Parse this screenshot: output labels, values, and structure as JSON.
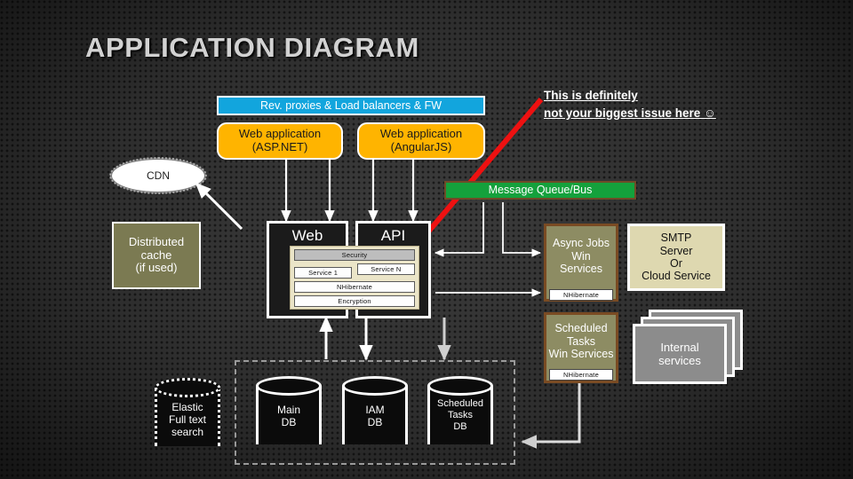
{
  "slide": {
    "title": "APPLICATION DIAGRAM",
    "background_color": "#323232",
    "annotation": {
      "line1": "This is definitely",
      "line2": "not your biggest issue here ☺",
      "arrow_color": "#ee1111"
    }
  },
  "colors": {
    "blue_bar": "#12a5dd",
    "gold": "#ffb400",
    "green_bar": "#14a13c",
    "olive": "#7b7a52",
    "olive_brown": "#8d8c63",
    "cream": "#ded8b0",
    "grey_card": "#8c8c8c",
    "white": "#ffffff",
    "red_arrow": "#ee1111"
  },
  "nodes": {
    "load_balancers": "Rev. proxies & Load balancers & FW",
    "web_app_aspnet": {
      "line1": "Web application",
      "line2": "(ASP.NET)"
    },
    "web_app_angular": {
      "line1": "Web application",
      "line2": "(AngularJS)"
    },
    "cdn": "CDN",
    "message_queue": "Message Queue/Bus",
    "distributed_cache": {
      "line1": "Distributed",
      "line2": "cache",
      "line3": "(if used)"
    },
    "web": "Web",
    "api": "API",
    "async_jobs": {
      "line1": "Async Jobs",
      "line2": "Win",
      "line3": "Services",
      "tag": "NHibernate"
    },
    "smtp": {
      "line1": "SMTP",
      "line2": "Server",
      "line3": "Or",
      "line4": "Cloud Service"
    },
    "scheduled_tasks": {
      "line1": "Scheduled",
      "line2": "Tasks",
      "line3": "Win Services",
      "tag": "NHibernate"
    },
    "internal_services": {
      "line1": "Internal",
      "line2": "services"
    }
  },
  "stack": {
    "security": "Security",
    "service_first": "Service 1",
    "service_last": "Service N",
    "nhibernate": "NHibernate",
    "encryption": "Encryption"
  },
  "databases": [
    {
      "name": "elastic",
      "line1": "Elastic",
      "line2": "Full text",
      "line3": "search",
      "style": "dashed"
    },
    {
      "name": "main-db",
      "line1": "Main",
      "line2": "DB",
      "style": "solid"
    },
    {
      "name": "iam-db",
      "line1": "IAM",
      "line2": "DB",
      "style": "solid"
    },
    {
      "name": "scheduled-tasks-db",
      "line1": "Scheduled",
      "line2": "Tasks",
      "line3": "DB",
      "style": "solid"
    }
  ]
}
